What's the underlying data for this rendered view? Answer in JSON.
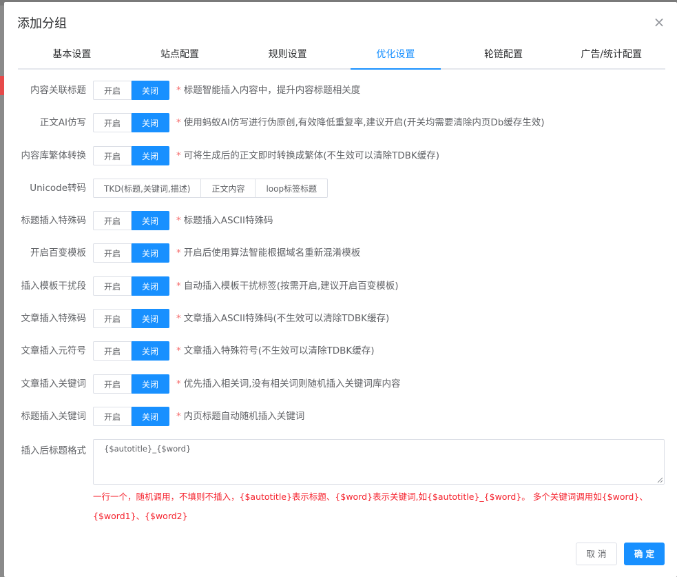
{
  "dialog": {
    "title": "添加分组",
    "close_symbol": "×"
  },
  "tabs": [
    {
      "label": "基本设置",
      "active": false
    },
    {
      "label": "站点配置",
      "active": false
    },
    {
      "label": "规则设置",
      "active": false
    },
    {
      "label": "优化设置",
      "active": true
    },
    {
      "label": "轮链配置",
      "active": false
    },
    {
      "label": "广告/统计配置",
      "active": false
    }
  ],
  "toggle": {
    "on_label": "开启",
    "off_label": "关闭"
  },
  "rows": [
    {
      "label": "内容关联标题",
      "value": "关闭",
      "hint": "标题智能插入内容中，提升内容标题相关度"
    },
    {
      "label": "正文AI仿写",
      "value": "关闭",
      "hint": "使用蚂蚁AI仿写进行伪原创,有效降低重复率,建议开启(开关均需要清除内页Db缓存生效)"
    },
    {
      "label": "内容库繁体转换",
      "value": "关闭",
      "hint": "可将生成后的正文即时转换成繁体(不生效可以清除TDBK缓存)"
    },
    {
      "label": "标题插入特殊码",
      "value": "关闭",
      "hint": "标题插入ASCII特殊码"
    },
    {
      "label": "开启百变模板",
      "value": "关闭",
      "hint": "开启后使用算法智能根据域名重新混淆模板"
    },
    {
      "label": "插入模板干扰段",
      "value": "关闭",
      "hint": "自动插入模板干扰标签(按需开启,建议开启百变模板)"
    },
    {
      "label": "文章插入特殊码",
      "value": "关闭",
      "hint": "文章插入ASCII特殊码(不生效可以清除TDBK缓存)"
    },
    {
      "label": "文章插入元符号",
      "value": "关闭",
      "hint": "文章插入特殊符号(不生效可以清除TDBK缓存)"
    },
    {
      "label": "文章插入关键词",
      "value": "关闭",
      "hint": "优先插入相关词,没有相关词则随机插入关键词库内容"
    },
    {
      "label": "标题插入关键词",
      "value": "关闭",
      "hint": "内页标题自动随机插入关键词"
    }
  ],
  "unicode": {
    "label": "Unicode转码",
    "options": [
      "TKD(标题,关键词,描述)",
      "正文内容",
      "loop标签标题"
    ]
  },
  "hint_star": "*",
  "title_format": {
    "label": "插入后标题格式",
    "value": "{$autotitle}_{$word}",
    "help": "一行一个，随机调用，不填则不插入，{$autotitle}表示标题、{$word}表示关键词,如{$autotitle}_{$word}。 多个关键词调用如{$word}、{$word1}、{$word2}"
  },
  "footer": {
    "cancel_label": "取 消",
    "ok_label": "确 定"
  },
  "colors": {
    "primary": "#1890ff",
    "hint_star": "#f56c6c",
    "help_text": "#f5222d"
  }
}
